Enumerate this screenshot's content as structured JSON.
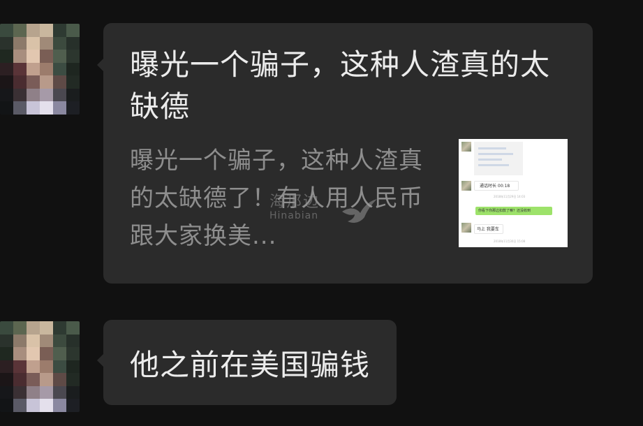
{
  "messages": [
    {
      "type": "link",
      "title": "曝光一个骗子，这种人渣真的太缺德",
      "description": "曝光一个骗子，这种人渣真的太缺德了！有人用人民币跟大家换美...",
      "thumbnail": {
        "call_label": "通话时长 00:18",
        "green_message": "你看下你那边扣款了嘛？还没收到",
        "reply": "马上 我要车"
      },
      "watermark": {
        "cn": "海那边",
        "en": "Hinabian"
      }
    },
    {
      "type": "text",
      "text": "他之前在美国骗钱"
    }
  ],
  "colors": {
    "background": "#111111",
    "bubble": "#2b2b2b",
    "primary_text": "#ececec",
    "secondary_text": "#8e8e8e",
    "wechat_green": "#9de26a"
  }
}
